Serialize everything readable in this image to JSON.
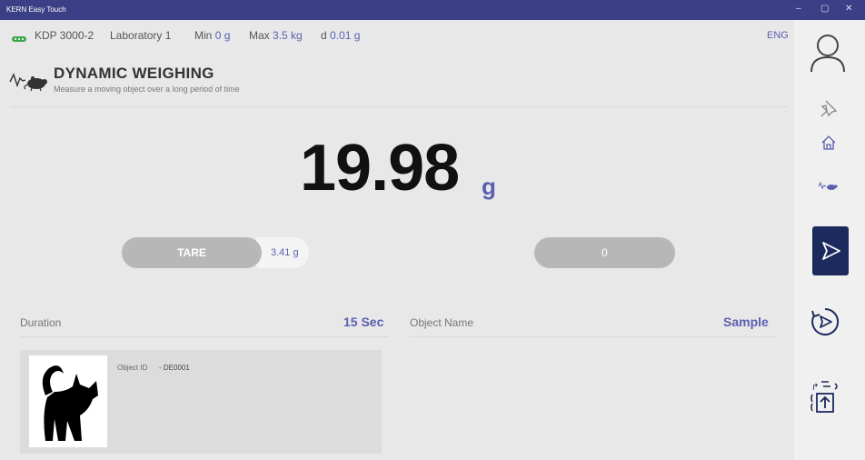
{
  "window": {
    "title": "KERN Easy Touch",
    "controls": {
      "minimize": "–",
      "maximize": "▢",
      "close": "✕"
    }
  },
  "header": {
    "device_model": "KDP 3000-2",
    "location": "Laboratory 1",
    "min_label": "Min",
    "min_value": "0 g",
    "max_label": "Max",
    "max_value": "3.5 kg",
    "d_label": "d",
    "d_value": "0.01 g",
    "language": "ENG"
  },
  "mode": {
    "title": "DYNAMIC WEIGHING",
    "subtitle": "Measure a moving object over a long period of time"
  },
  "display": {
    "weight": "19.98",
    "unit": "g"
  },
  "controls": {
    "tare_label": "TARE",
    "tare_value": "3.41 g",
    "zero_label": "0"
  },
  "fields": {
    "duration_label": "Duration",
    "duration_value": "15 Sec",
    "object_name_label": "Object Name",
    "object_name_value": "Sample"
  },
  "object_card": {
    "id_label": "Object ID",
    "id_value": "- DE0001",
    "image_icon": "cat-icon"
  },
  "sidebar": {
    "icons": [
      "user-icon",
      "pin-icon",
      "home-icon",
      "dynamic-weighing-icon",
      "send-icon",
      "start-timer-icon",
      "export-icon"
    ]
  },
  "colors": {
    "accent": "#5a5fb0",
    "titlebar": "#3b3f86",
    "send_button": "#1d2a5e",
    "device_icon": "#3aa84a",
    "pill_button": "#b7b7b7"
  }
}
